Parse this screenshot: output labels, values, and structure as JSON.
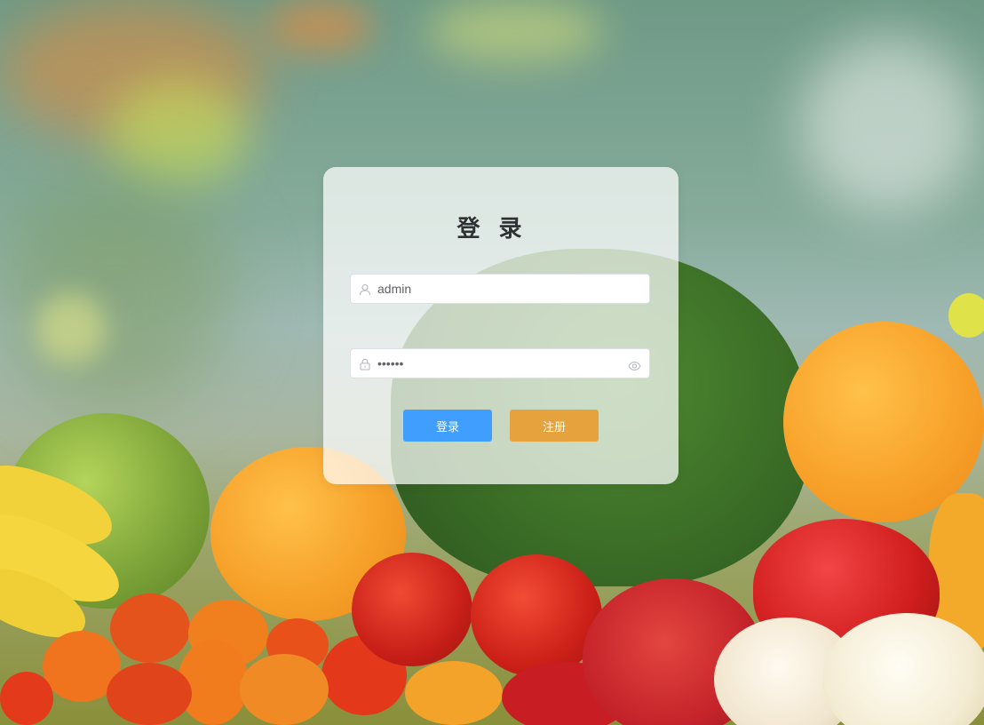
{
  "login_form": {
    "title": "登 录",
    "username": {
      "value": "admin",
      "icon": "user-icon"
    },
    "password": {
      "value": "••••••",
      "icon": "lock-icon",
      "toggle_icon": "eye-icon"
    },
    "login_button": "登录",
    "register_button": "注册"
  },
  "colors": {
    "login_button": "#409eff",
    "register_button": "#e6a23c",
    "title": "#303133"
  }
}
